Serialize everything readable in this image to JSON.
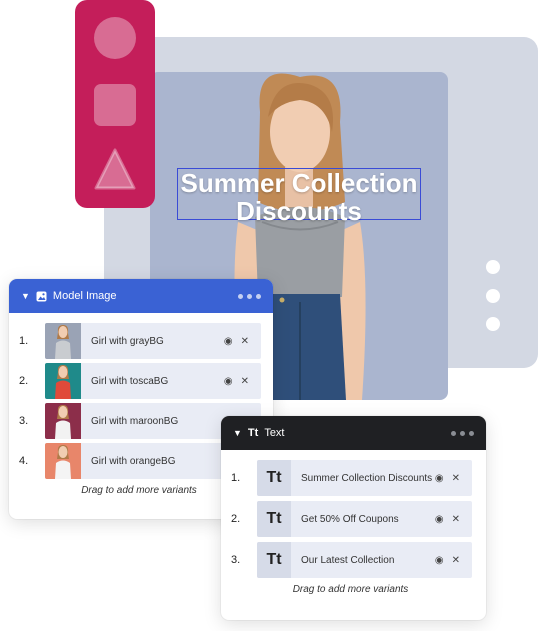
{
  "canvas": {
    "headline": "Summer Collection Discounts"
  },
  "model_panel": {
    "title": "Model Image",
    "items": [
      {
        "num": "1.",
        "label": "Girl with grayBG",
        "bg": "#9aa3b5",
        "shirt": "#c9ccd0"
      },
      {
        "num": "2.",
        "label": "Girl with toscaBG",
        "bg": "#1f8a8a",
        "shirt": "#e04a3a"
      },
      {
        "num": "3.",
        "label": "Girl with maroonBG",
        "bg": "#8c2e4a",
        "shirt": "#f2f2f2"
      },
      {
        "num": "4.",
        "label": "Girl with orangeBG",
        "bg": "#e8866a",
        "shirt": "#f4f4f4"
      }
    ],
    "hint": "Drag to add more variants"
  },
  "text_panel": {
    "title": "Text",
    "icon_text": "Tt",
    "items": [
      {
        "num": "1.",
        "thumb": "Tt",
        "label": "Summer Collection Discounts"
      },
      {
        "num": "2.",
        "thumb": "Tt",
        "label": "Get 50% Off Coupons"
      },
      {
        "num": "3.",
        "thumb": "Tt",
        "label": "Our Latest Collection"
      }
    ],
    "hint": "Drag to add more variants"
  },
  "colors": {
    "accent_blue": "#3a62d4",
    "toolbar_pink": "#c41e5a",
    "dark_header": "#1f2023"
  }
}
